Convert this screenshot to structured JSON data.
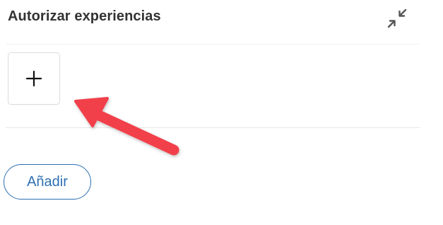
{
  "panel": {
    "title": "Autorizar experiencias",
    "collapse_icon": "collapse-arrows-icon",
    "add_tile_icon": "plus-icon"
  },
  "actions": {
    "add_label": "Añadir"
  },
  "colors": {
    "title": "#333333",
    "accent": "#2d6fb3",
    "annotation_arrow": "#f2414b"
  }
}
